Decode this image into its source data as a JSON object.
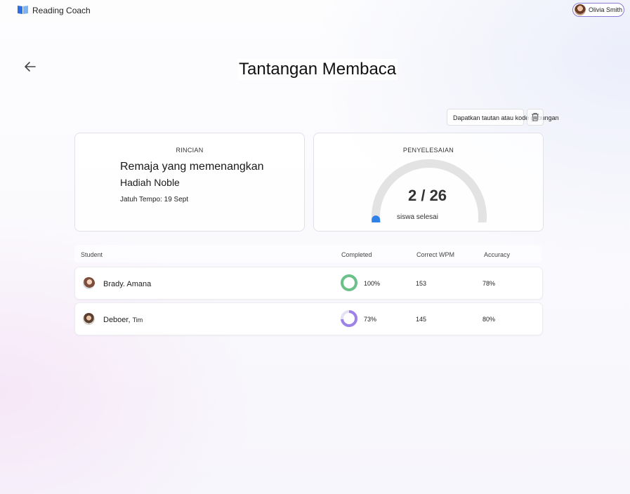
{
  "app": {
    "title": "Reading Coach"
  },
  "user": {
    "name": "Olivia Smith"
  },
  "page": {
    "title": "Tantangan Membaca"
  },
  "actions": {
    "link_label": "Dapatkan tautan atau kode gabungan",
    "delete_icon": "trash-icon"
  },
  "details": {
    "heading": "RINCIAN",
    "book_title_line1": "Remaja yang memenangkan",
    "book_title_line2": "Hadiah Noble",
    "due": "Jatuh Tempo: 19 Sept"
  },
  "completion": {
    "heading": "PENYELESAIAN",
    "completed": 2,
    "total": 26,
    "count_text": "2 / 26",
    "label": "siswa selesai"
  },
  "table": {
    "headers": [
      "Student",
      "Completed",
      "Correct WPM",
      "Accuracy"
    ],
    "rows": [
      {
        "name": "Brady. Amana",
        "name_extra": "",
        "completed_text": "100%",
        "completed": 1.0,
        "wpm": "153",
        "accuracy": "78%",
        "ring_color": "#6cc08a"
      },
      {
        "name": "Deboer,",
        "name_extra": "Tim",
        "completed_text": "73%",
        "completed": 0.73,
        "wpm": "145",
        "accuracy": "80%",
        "ring_color": "#9d82e8"
      }
    ]
  },
  "colors": {
    "accent_blue": "#2f80e8",
    "gauge_track": "#e3e3e3"
  }
}
